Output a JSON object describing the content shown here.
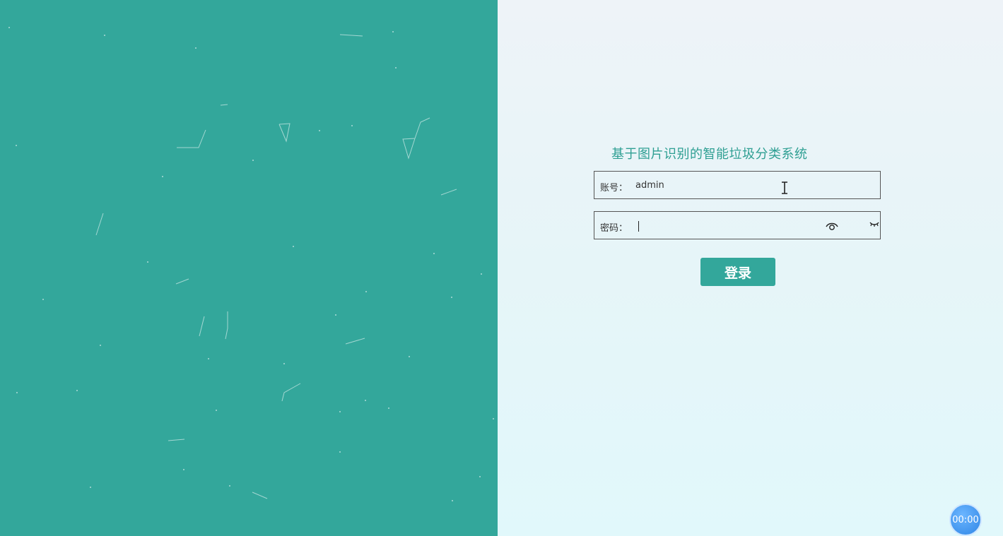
{
  "login": {
    "title": "基于图片识别的智能垃圾分类系统",
    "account_label": "账号：",
    "account_value": "admin",
    "password_label": "密码：",
    "password_value": "",
    "login_button": "登录"
  },
  "timer": {
    "value": "00:00"
  },
  "colors": {
    "brand": "#33a79b",
    "title": "#2f9f93",
    "timer": "#2f86e6"
  },
  "icons": {
    "show_password": "eye-icon",
    "hide_password": "eye-closed-icon",
    "cursor": "text-cursor-icon"
  }
}
